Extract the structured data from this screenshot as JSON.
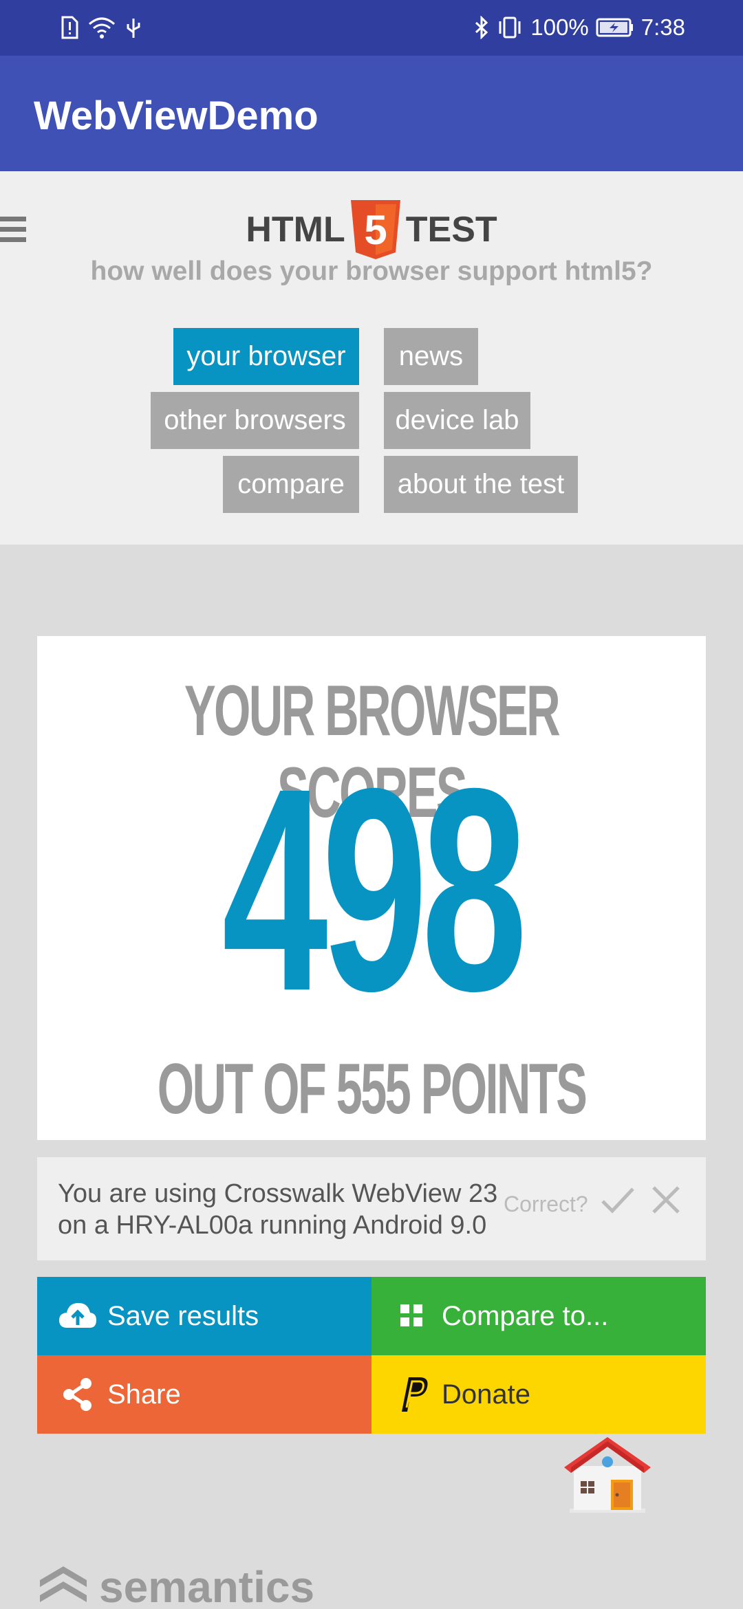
{
  "status_bar": {
    "battery": "100%",
    "time": "7:38"
  },
  "app_bar": {
    "title": "WebViewDemo"
  },
  "header": {
    "logo_left": "HTML",
    "logo_number": "5",
    "logo_right": "TEST",
    "tagline": "how well does your browser support html5?"
  },
  "nav": {
    "your_browser": "your browser",
    "news": "news",
    "other_browsers": "other browsers",
    "device_lab": "device lab",
    "compare": "compare",
    "about": "about the test"
  },
  "score": {
    "heading": "YOUR BROWSER SCORES",
    "value": "498",
    "total": "OUT OF 555 POINTS"
  },
  "notice": {
    "line1": "You are using Crosswalk WebView 23",
    "line2": "on a HRY-AL00a running Android 9.0",
    "correct": "Correct?"
  },
  "actions": {
    "save": "Save results",
    "compare": "Compare to...",
    "share": "Share",
    "donate": "Donate"
  },
  "sponsor": {
    "name": "semantics"
  },
  "colors": {
    "status_bar": "#303f9f",
    "app_bar": "#3f51b5",
    "accent_blue": "#0894c2",
    "green": "#38b13a",
    "orange": "#ec6637",
    "yellow": "#fdd600",
    "html5_orange": "#e44d26"
  }
}
